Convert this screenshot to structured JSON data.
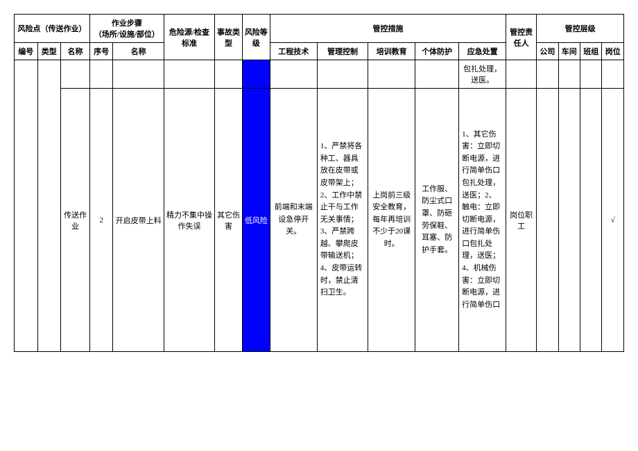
{
  "header": {
    "risk_point": "风险点（传送作业）",
    "step_group": "作业步骤\n（场所/设施/部位）",
    "hazard_std": "危险源/检查标准",
    "accident_type": "事故类型",
    "risk_level": "风险等级",
    "control_measures": "管控措施",
    "responsible": "管控责任人",
    "control_level": "管控层级",
    "num": "编号",
    "type": "类型",
    "name": "名称",
    "seq": "序号",
    "stepname": "名称",
    "eng": "工程技术",
    "mgmt": "管理控制",
    "train": "培训教育",
    "ppe": "个体防护",
    "emerg": "应急处置",
    "company": "公司",
    "workshop": "车间",
    "team": "班组",
    "post": "岗位"
  },
  "prev_row": {
    "emerg": "包扎处理，送医。"
  },
  "row": {
    "name": "传送作业",
    "seq": "2",
    "stepname": "开启皮带上料",
    "hazard": "精力不集中操作失误",
    "accident": "其它伤害",
    "risk_level": "低风险",
    "eng": "前端和末端设急停开关。",
    "mgmt": "1、严禁将各种工、器具放在皮带或皮带架上；2、工作中禁止干与工作无关事情；3、严禁跨越、攀爬皮带输送机；4、皮带运转时，禁止清扫卫生。",
    "train": "上岗前三级安全教育，每年再培训不少于20课时。",
    "ppe": "工作服、防尘式口罩、防砸劳保鞋、耳塞、防护手套。",
    "emerg": "1、其它伤害：立即切断电源，进行简单伤口包扎处理，送医；2、触电：立即切断电源，进行简单伤口包扎处理，送医；4、机械伤害：立即切断电源，进行简单伤口",
    "responsible": "岗位职工",
    "post_mark": "√"
  }
}
